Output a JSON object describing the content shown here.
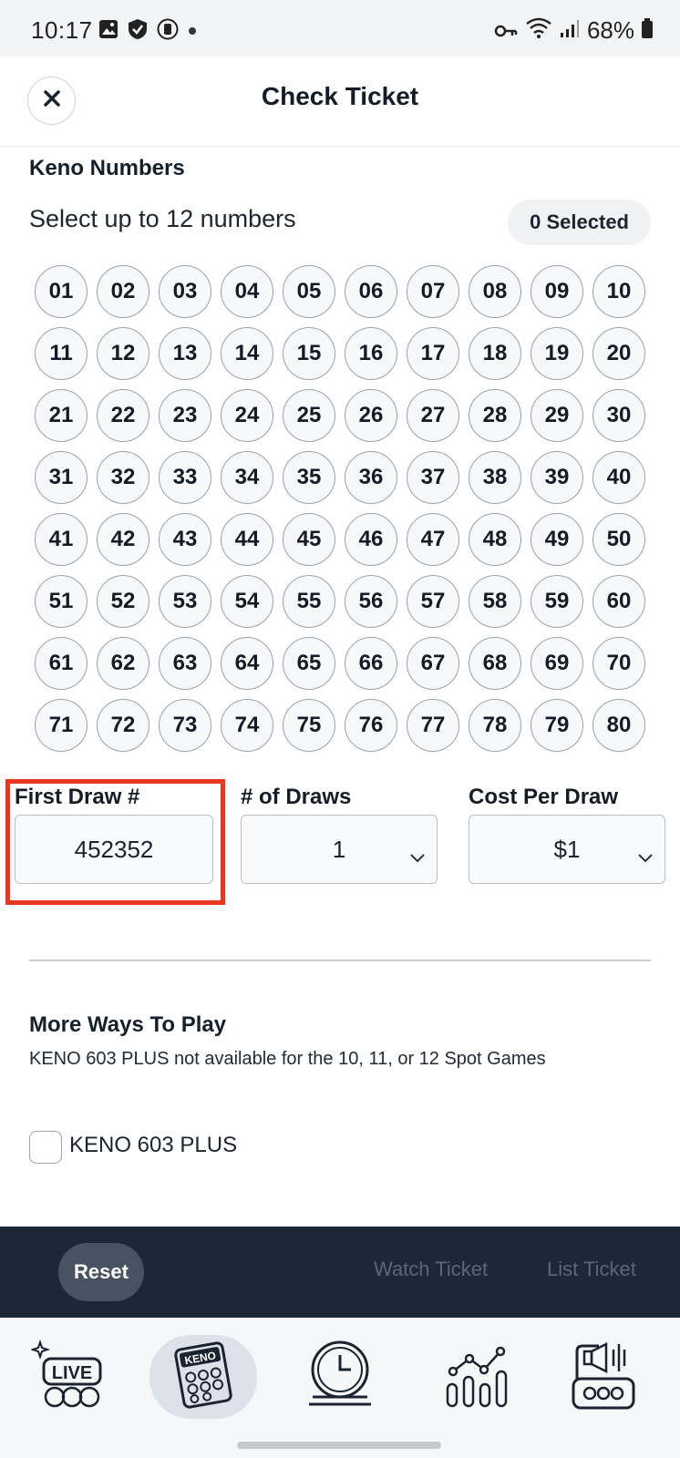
{
  "status_bar": {
    "time": "10:17",
    "battery": "68%"
  },
  "header": {
    "title": "Check Ticket"
  },
  "keno": {
    "section_title": "Keno Numbers",
    "subtitle": "Select up to 12 numbers",
    "selected_badge": "0 Selected",
    "numbers": [
      "01",
      "02",
      "03",
      "04",
      "05",
      "06",
      "07",
      "08",
      "09",
      "10",
      "11",
      "12",
      "13",
      "14",
      "15",
      "16",
      "17",
      "18",
      "19",
      "20",
      "21",
      "22",
      "23",
      "24",
      "25",
      "26",
      "27",
      "28",
      "29",
      "30",
      "31",
      "32",
      "33",
      "34",
      "35",
      "36",
      "37",
      "38",
      "39",
      "40",
      "41",
      "42",
      "43",
      "44",
      "45",
      "46",
      "47",
      "48",
      "49",
      "50",
      "51",
      "52",
      "53",
      "54",
      "55",
      "56",
      "57",
      "58",
      "59",
      "60",
      "61",
      "62",
      "63",
      "64",
      "65",
      "66",
      "67",
      "68",
      "69",
      "70",
      "71",
      "72",
      "73",
      "74",
      "75",
      "76",
      "77",
      "78",
      "79",
      "80"
    ]
  },
  "fields": {
    "first_draw": {
      "label": "First Draw #",
      "value": "452352"
    },
    "draws": {
      "label": "# of Draws",
      "value": "1"
    },
    "cost": {
      "label": "Cost Per Draw",
      "value": "$1"
    }
  },
  "more_ways": {
    "title": "More Ways To Play",
    "note": "KENO 603 PLUS not available for the 10, 11, or 12 Spot Games",
    "checkbox_label": "KENO 603 PLUS"
  },
  "actions": {
    "reset": "Reset",
    "watch": "Watch Ticket",
    "list": "List Ticket"
  },
  "tabs": {
    "live_text": "LIVE",
    "keno_text": "KENO"
  },
  "colors": {
    "highlight": "#e8371d",
    "action_bar": "#1e2736"
  }
}
